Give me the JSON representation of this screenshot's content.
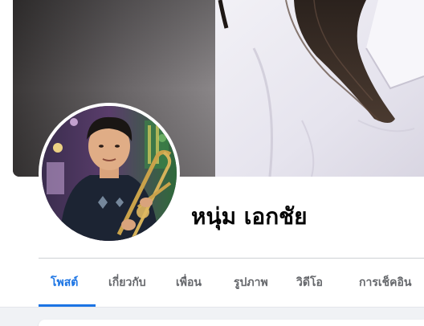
{
  "profile": {
    "name": "หนุ่ม เอกชัย"
  },
  "tabs": [
    {
      "label": "โพสต์",
      "active": true
    },
    {
      "label": "เกี่ยวกับ",
      "active": false
    },
    {
      "label": "เพื่อน",
      "active": false
    },
    {
      "label": "รูปภาพ",
      "active": false
    },
    {
      "label": "วิดีโอ",
      "active": false
    },
    {
      "label": "การเช็คอิน",
      "active": false
    }
  ],
  "colors": {
    "accent": "#1b74e4",
    "tab_text": "#65676b",
    "name_text": "#050505",
    "divider": "#ced0d4",
    "page_bg": "#f0f2f5"
  }
}
